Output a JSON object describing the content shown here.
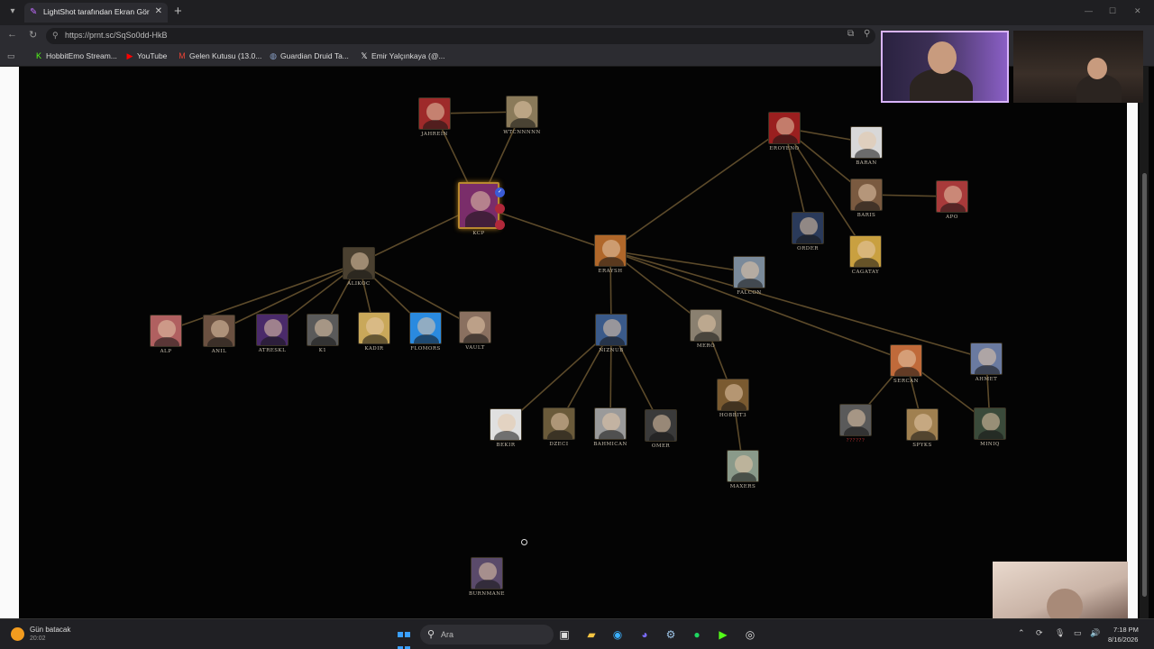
{
  "browser": {
    "tab_title": "LightShot tarafından Ekran Görüntü",
    "url": "https://prnt.sc/SqSo0dd-HkB",
    "bookmarks": [
      {
        "label": "HobbitEmo Stream...",
        "icon": "kick-icon",
        "color": "#53fc18"
      },
      {
        "label": "YouTube",
        "icon": "youtube-icon",
        "color": "#ff0000"
      },
      {
        "label": "Gelen Kutusu (13.0...",
        "icon": "gmail-icon",
        "color": "#ea4335"
      },
      {
        "label": "Guardian Druid Ta...",
        "icon": "globe-icon",
        "color": "#8aa0c8"
      },
      {
        "label": "Emir Yalçınkaya (@...",
        "icon": "x-icon",
        "color": "#ffffff"
      }
    ]
  },
  "tree": {
    "center": {
      "name": "KCP",
      "color": "#7a2d6a"
    },
    "nodes": [
      {
        "id": "jahrein",
        "name": "JAHREIN",
        "color": "#9e2a2a"
      },
      {
        "id": "wtcn",
        "name": "WTCNNNNN",
        "color": "#8a7a5a"
      },
      {
        "id": "alikoc",
        "name": "ALIKOC",
        "color": "#4a4030"
      },
      {
        "id": "eraysh",
        "name": "ERAYSH",
        "color": "#b0672a"
      },
      {
        "id": "eroyeno",
        "name": "EROYENO",
        "color": "#9a1f1f"
      },
      {
        "id": "baran",
        "name": "BARAN",
        "color": "#d8d8d8"
      },
      {
        "id": "baris",
        "name": "BARIS",
        "color": "#7a5a40"
      },
      {
        "id": "apo",
        "name": "APO",
        "color": "#a83a3a"
      },
      {
        "id": "order",
        "name": "ORDER",
        "color": "#2a3a5a"
      },
      {
        "id": "cagatay",
        "name": "CAGATAY",
        "color": "#c9a040"
      },
      {
        "id": "falcon",
        "name": "FALCON",
        "color": "#7a8a9a"
      },
      {
        "id": "alp",
        "name": "ALP",
        "color": "#b06060"
      },
      {
        "id": "anil",
        "name": "ANIL",
        "color": "#6a5040"
      },
      {
        "id": "atreskl",
        "name": "ATRESKL",
        "color": "#4a2a6a"
      },
      {
        "id": "k1",
        "name": "K1",
        "color": "#5a5a5a"
      },
      {
        "id": "kadir",
        "name": "KADIR",
        "color": "#c9a85a"
      },
      {
        "id": "flomors",
        "name": "FLOMORS",
        "color": "#2a8adf"
      },
      {
        "id": "vault",
        "name": "VAULT",
        "color": "#8a7060"
      },
      {
        "id": "nizniub",
        "name": "NIZNUB",
        "color": "#3a5a8a"
      },
      {
        "id": "mero",
        "name": "MERO",
        "color": "#8a8070"
      },
      {
        "id": "sercan",
        "name": "SERCAN",
        "color": "#c06a3a"
      },
      {
        "id": "ahmet",
        "name": "AHMET",
        "color": "#6a7aa0"
      },
      {
        "id": "bekir",
        "name": "BEKIR",
        "color": "#e0e0e0"
      },
      {
        "id": "dzeci",
        "name": "DZECI",
        "color": "#6a5a3a"
      },
      {
        "id": "bahmican",
        "name": "BAHMICAN",
        "color": "#9a9a9a"
      },
      {
        "id": "omer",
        "name": "OMER",
        "color": "#3a3a3a"
      },
      {
        "id": "hobbit",
        "name": "HOBBIT3",
        "color": "#7a5a30"
      },
      {
        "id": "maxers",
        "name": "MAXERS",
        "color": "#8a9a8a"
      },
      {
        "id": "unknown",
        "name": "??????",
        "color": "#5a5a5a",
        "red": true
      },
      {
        "id": "spyks",
        "name": "SPYKS",
        "color": "#a08050"
      },
      {
        "id": "miniq",
        "name": "MINIQ",
        "color": "#3a4a3a"
      },
      {
        "id": "burnmane",
        "name": "BURNMANE",
        "color": "#5a4a6a"
      }
    ]
  },
  "taskbar": {
    "weather_title": "Gün batacak",
    "weather_time": "20:02",
    "search_placeholder": "Ara",
    "time": "7:18 PM",
    "date": "8/16/2026"
  }
}
